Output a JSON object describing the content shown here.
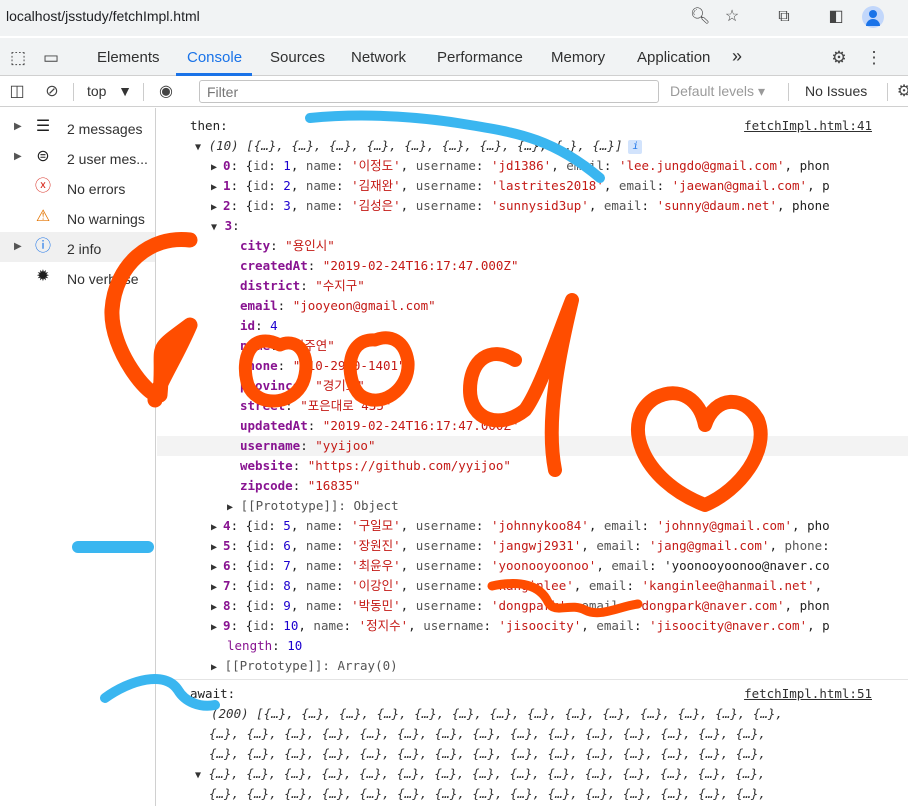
{
  "browser": {
    "url": "localhost/jsstudy/fetchImpl.html",
    "icons": [
      "zoom-icon",
      "star-icon",
      "extensions-icon",
      "sidepanel-icon",
      "profile-avatar"
    ]
  },
  "devtools": {
    "tabs": [
      "Elements",
      "Console",
      "Sources",
      "Network",
      "Performance",
      "Memory",
      "Application"
    ],
    "more_tabs": "»",
    "settings_glyph": "⚙",
    "menu_glyph": "⋮"
  },
  "console_toolbar": {
    "context": "top",
    "filter_placeholder": "Filter",
    "levels": "Default levels",
    "issues": "No Issues"
  },
  "sidebar": {
    "items": [
      {
        "label": "2 messages",
        "icon": "list-icon"
      },
      {
        "label": "2 user mes...",
        "icon": "user-icon"
      },
      {
        "label": "No errors",
        "icon": "error-icon"
      },
      {
        "label": "No warnings",
        "icon": "warning-icon"
      },
      {
        "label": "2 info",
        "icon": "info-icon"
      },
      {
        "label": "No verbose",
        "icon": "bug-icon"
      }
    ]
  },
  "log": {
    "then_label": "then:",
    "then_source": "fetchImpl.html:41",
    "array_summary": "(10) [{…}, {…}, {…}, {…}, {…}, {…}, {…}, {…}, {…}, {…}]",
    "info_badge": "i",
    "rows_before": [
      {
        "index": "0",
        "text": "{id: 1, name: '이정도', username: 'jd1386', email: 'lee.jungdo@gmail.com', phon"
      },
      {
        "index": "1",
        "text": "{id: 2, name: '김재완', username: 'lastrites2018', email: 'jaewan@gmail.com', p"
      },
      {
        "index": "2",
        "text": "{id: 3, name: '김성은', username: 'sunnysid3up', email: 'sunny@daum.net', phone"
      }
    ],
    "expanded_index": "3",
    "expanded_fields": [
      {
        "key": "city",
        "value": "\"용인시\"",
        "type": "str"
      },
      {
        "key": "createdAt",
        "value": "\"2019-02-24T16:17:47.000Z\"",
        "type": "str"
      },
      {
        "key": "district",
        "value": "\"수지구\"",
        "type": "str"
      },
      {
        "key": "email",
        "value": "\"jooyeon@gmail.com\"",
        "type": "str"
      },
      {
        "key": "id",
        "value": "4",
        "type": "num"
      },
      {
        "key": "name",
        "value": "\"이주연\"",
        "type": "str"
      },
      {
        "key": "phone",
        "value": "\"010-2940-1401\"",
        "type": "str"
      },
      {
        "key": "province",
        "value": "\"경기도\"",
        "type": "str"
      },
      {
        "key": "street",
        "value": "\"포은대로 435\"",
        "type": "str"
      },
      {
        "key": "updatedAt",
        "value": "\"2019-02-24T16:17:47.000Z\"",
        "type": "str"
      },
      {
        "key": "username",
        "value": "\"yyijoo\"",
        "type": "str"
      },
      {
        "key": "website",
        "value": "\"https://github.com/yyijoo\"",
        "type": "str"
      },
      {
        "key": "zipcode",
        "value": "\"16835\"",
        "type": "str"
      }
    ],
    "expanded_proto": "[[Prototype]]: Object",
    "rows_after": [
      {
        "index": "4",
        "text": "{id: 5, name: '구일모', username: 'johnnykoo84', email: 'johnny@gmail.com', pho"
      },
      {
        "index": "5",
        "text": "{id: 6, name: '장원진', username: 'jangwj2931', email: 'jang@gmail.com', phone:"
      },
      {
        "index": "6",
        "text": "{id: 7, name: '최윤우', username: 'yoonooyoonoo', email: 'yoonooyoonoo@naver.co"
      },
      {
        "index": "7",
        "text": "{id: 8, name: '이강인', username: 'kanginlee', email: 'kanginlee@hanmail.net',"
      },
      {
        "index": "8",
        "text": "{id: 9, name: '박동민', username: 'dongpark', email: 'dongpark@naver.com', phon"
      },
      {
        "index": "9",
        "text": "{id: 10, name: '정지수', username: 'jisoocity', email: 'jisoocity@naver.com', p"
      }
    ],
    "length_key": "length",
    "length_value": "10",
    "array_proto": "[[Prototype]]: Array(0)",
    "await_label": "await:",
    "await_source": "fetchImpl.html:51",
    "await_summary": "(200) [{…}, {…}, {…}, {…}, {…}, {…}, {…}, {…}, {…}, {…}, {…}, {…}, {…}, {…},",
    "await_cont": "{…}, {…}, {…}, {…}, {…}, {…}, {…}, {…}, {…}, {…}, {…}, {…}, {…}, {…}, {…},"
  },
  "doodle": {
    "text": "Good",
    "colors": {
      "orange": "#ff4d00",
      "blue": "#3ab6f0"
    }
  }
}
